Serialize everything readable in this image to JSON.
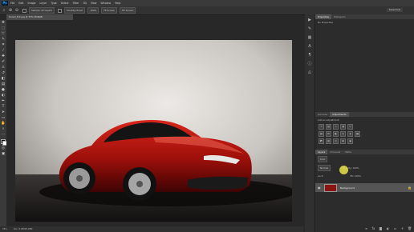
{
  "app": {
    "logo": "Ps"
  },
  "menu": [
    "File",
    "Edit",
    "Image",
    "Layer",
    "Type",
    "Select",
    "Filter",
    "3D",
    "View",
    "Window",
    "Help"
  ],
  "options": {
    "sample_label": "Sample: All Layers",
    "scrubby_label": "Scrubby Zoom",
    "zoom_value": "100%",
    "fit_screen": "Fit Screen",
    "fill_screen": "Fill Screen",
    "workspace": "Essentials"
  },
  "document": {
    "tab_title": "ferrari_f12.jpg @ 33% (RGB/8)",
    "zoom": "33%",
    "doc_info": "Doc: 5.93M/5.93M"
  },
  "tools": [
    "move-icon",
    "marquee-icon",
    "lasso-icon",
    "quick-select-icon",
    "crop-icon",
    "eyedropper-icon",
    "healing-icon",
    "brush-icon",
    "stamp-icon",
    "history-brush-icon",
    "eraser-icon",
    "gradient-icon",
    "blur-icon",
    "dodge-icon",
    "pen-icon",
    "type-icon",
    "path-select-icon",
    "shape-icon",
    "hand-icon",
    "zoom-icon",
    "swap-colors-icon",
    "foreground-color-icon",
    "quick-mask-icon",
    "screen-mode-icon"
  ],
  "properties_panel": {
    "tabs": [
      "Properties",
      "Histogram"
    ],
    "content": "No Properties"
  },
  "adjustments_panel": {
    "tabs": [
      "Libraries",
      "Adjustments"
    ],
    "title": "Add an adjustment"
  },
  "layers_panel": {
    "tabs": [
      "Layers",
      "Channels",
      "Paths"
    ],
    "kind": "Kind",
    "blend_mode": "Normal",
    "opacity_label": "Opacity: 100%",
    "lock_label": "Lock:",
    "fill_label": "Fill: 100%",
    "layer_name": "Background"
  },
  "colors": {
    "accent": "#31a8ff",
    "cursor": "#e9e44a"
  }
}
